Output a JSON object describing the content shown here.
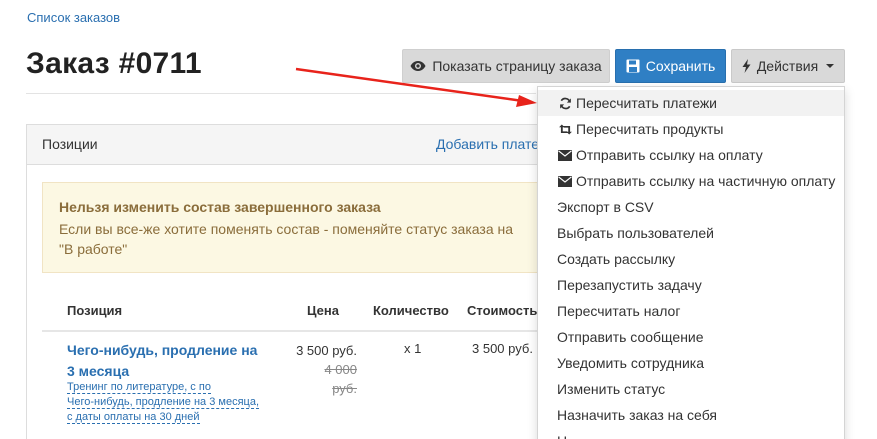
{
  "breadcrumb": {
    "label": "Список заказов"
  },
  "page": {
    "title": "Заказ #0711"
  },
  "toolbar": {
    "show_page_label": "Показать страницу заказа",
    "save_label": "Сохранить",
    "actions_label": "Действия",
    "icons": {
      "show": "eye-icon",
      "save": "floppy-disk-icon",
      "actions": "lightning-icon"
    },
    "colors": {
      "save_bg": "#2f7fc4",
      "default_bg": "#d9d9d9"
    }
  },
  "panel": {
    "header_label": "Позиции",
    "header_link": "Добавить плате",
    "alert": {
      "title": "Нельзя изменить состав завершенного заказа",
      "text": "Если вы все-же хотите поменять состав - поменяйте статус заказа на \"В работе\""
    },
    "table": {
      "columns": [
        "Позиция",
        "Цена",
        "Количество",
        "Стоимость"
      ],
      "rows": [
        {
          "name": "Чего-нибудь, продление на 3 месяца",
          "description_lines": [
            "Тренинг по литературе, с по",
            "Чего-нибудь, продление на 3 месяца,",
            "с даты оплаты на 30 дней"
          ],
          "price": "3 500 руб.",
          "old_price": "4 000 руб.",
          "quantity": "x 1",
          "cost": "3 500 руб."
        }
      ]
    }
  },
  "actions_menu": {
    "items": [
      {
        "label": "Пересчитать платежи",
        "icon": "refresh-icon",
        "active": true
      },
      {
        "label": "Пересчитать продукты",
        "icon": "retweet-icon"
      },
      {
        "label": "Отправить ссылку на оплату",
        "icon": "envelope-icon"
      },
      {
        "label": "Отправить ссылку на частичную оплату",
        "icon": "envelope-icon"
      },
      {
        "label": "Экспорт в CSV"
      },
      {
        "label": "Выбрать пользователей"
      },
      {
        "label": "Создать рассылку"
      },
      {
        "label": "Перезапустить задачу"
      },
      {
        "label": "Пересчитать налог"
      },
      {
        "label": "Отправить сообщение"
      },
      {
        "label": "Уведомить сотрудника"
      },
      {
        "label": "Изменить статус"
      },
      {
        "label": "Назначить заказ на себя"
      },
      {
        "label": "Н"
      }
    ]
  },
  "annotation": {
    "arrow_color": "#e8231b"
  }
}
